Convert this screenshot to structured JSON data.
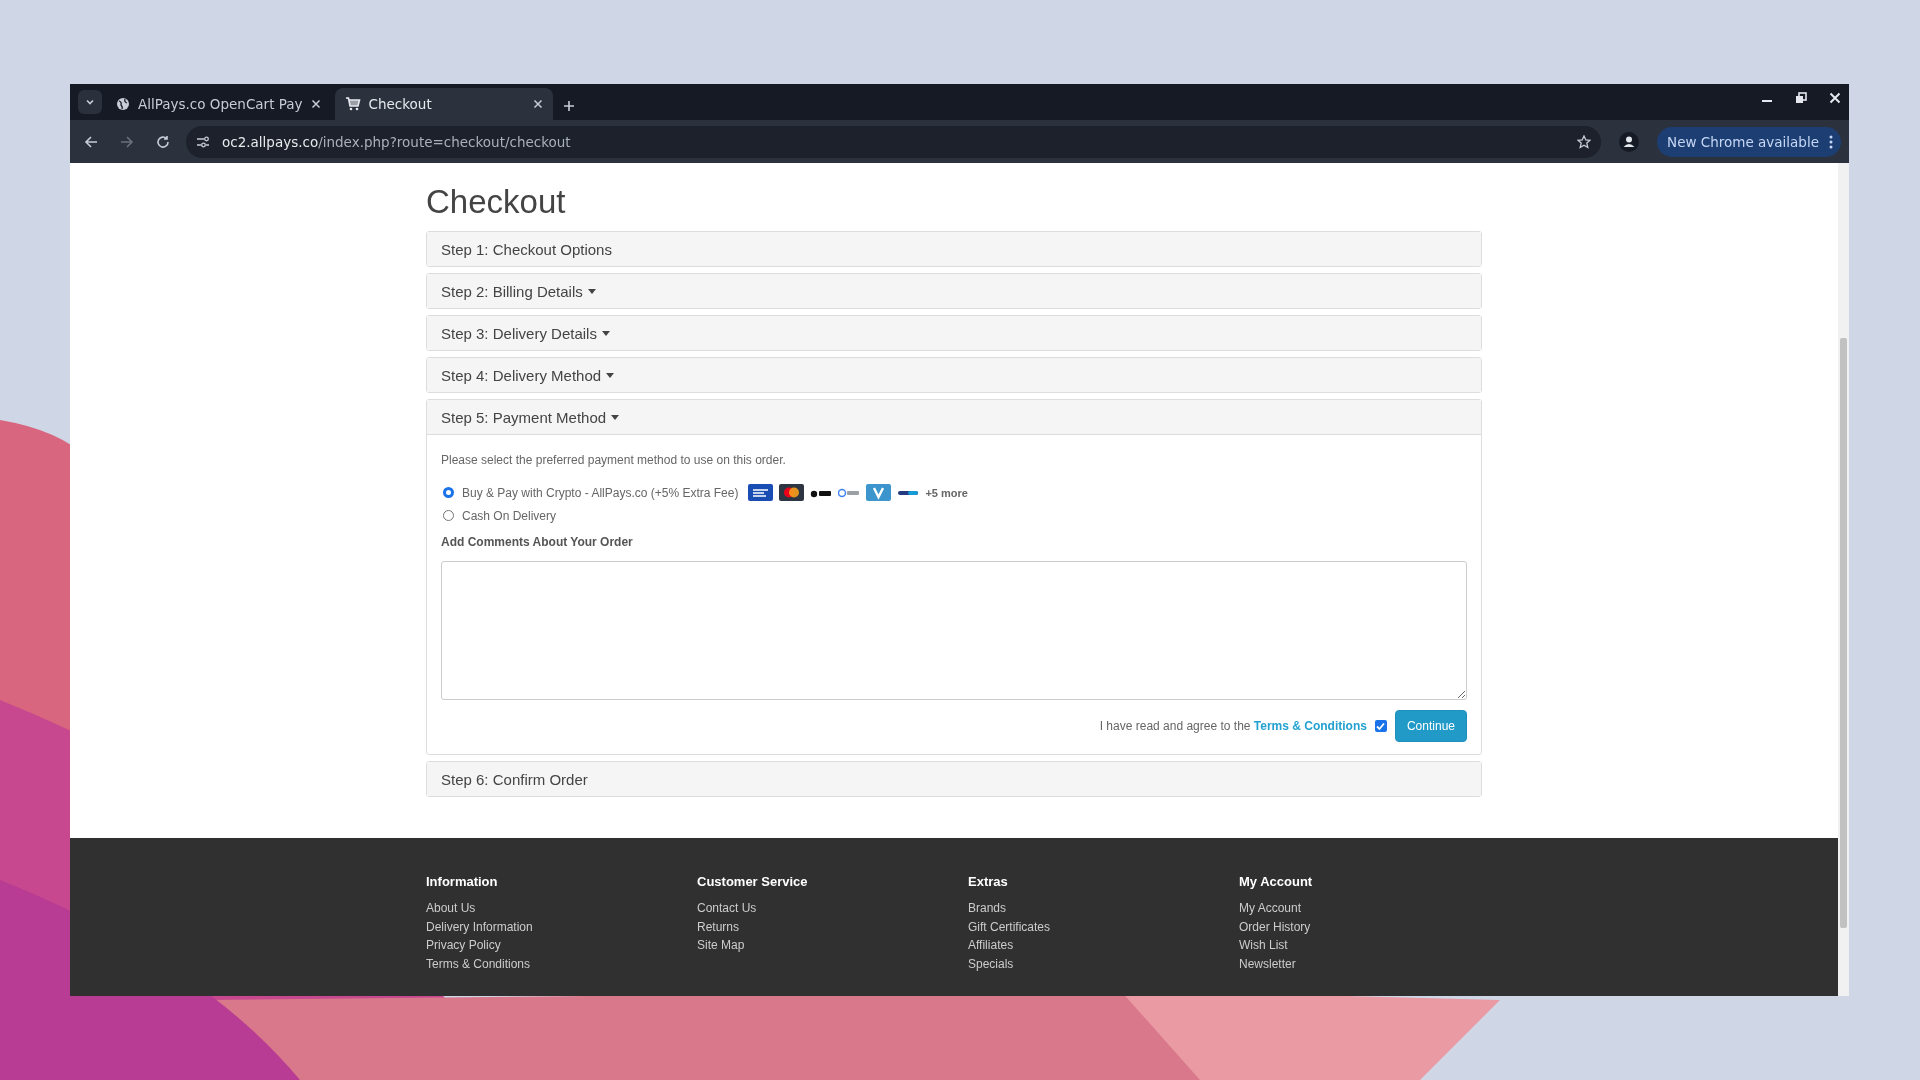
{
  "browser": {
    "tabs": [
      {
        "title": "AllPays.co OpenCart Pay",
        "kind": "globe",
        "selected": false
      },
      {
        "title": "Checkout",
        "kind": "cart",
        "selected": true
      }
    ],
    "url_host": "oc2.allpays.co",
    "url_path": "/index.php?route=checkout/checkout",
    "update_button": "New Chrome available"
  },
  "page": {
    "title": "Checkout",
    "steps": [
      {
        "label": "Step 1: Checkout Options",
        "caret": false,
        "expanded": false
      },
      {
        "label": "Step 2: Billing Details",
        "caret": true,
        "expanded": false
      },
      {
        "label": "Step 3: Delivery Details",
        "caret": true,
        "expanded": false
      },
      {
        "label": "Step 4: Delivery Method",
        "caret": true,
        "expanded": false
      },
      {
        "label": "Step 5: Payment Method",
        "caret": true,
        "expanded": true
      },
      {
        "label": "Step 6: Confirm Order",
        "caret": false,
        "expanded": false
      }
    ],
    "payment": {
      "intro": "Please select the preferred payment method to use on this order.",
      "methods": [
        {
          "label": "Buy & Pay with Crypto - AllPays.co (+5% Extra Fee)",
          "selected": true,
          "logos": true,
          "more": "+5 more"
        },
        {
          "label": "Cash On Delivery",
          "selected": false,
          "logos": false
        }
      ],
      "comments_label": "Add Comments About Your Order",
      "agree_text": "I have read and agree to the ",
      "terms_link": "Terms & Conditions",
      "agreed": true,
      "continue_button": "Continue"
    }
  },
  "footer": {
    "columns": [
      {
        "heading": "Information",
        "links": [
          "About Us",
          "Delivery Information",
          "Privacy Policy",
          "Terms & Conditions"
        ]
      },
      {
        "heading": "Customer Service",
        "links": [
          "Contact Us",
          "Returns",
          "Site Map"
        ]
      },
      {
        "heading": "Extras",
        "links": [
          "Brands",
          "Gift Certificates",
          "Affiliates",
          "Specials"
        ]
      },
      {
        "heading": "My Account",
        "links": [
          "My Account",
          "Order History",
          "Wish List",
          "Newsletter"
        ]
      }
    ]
  }
}
